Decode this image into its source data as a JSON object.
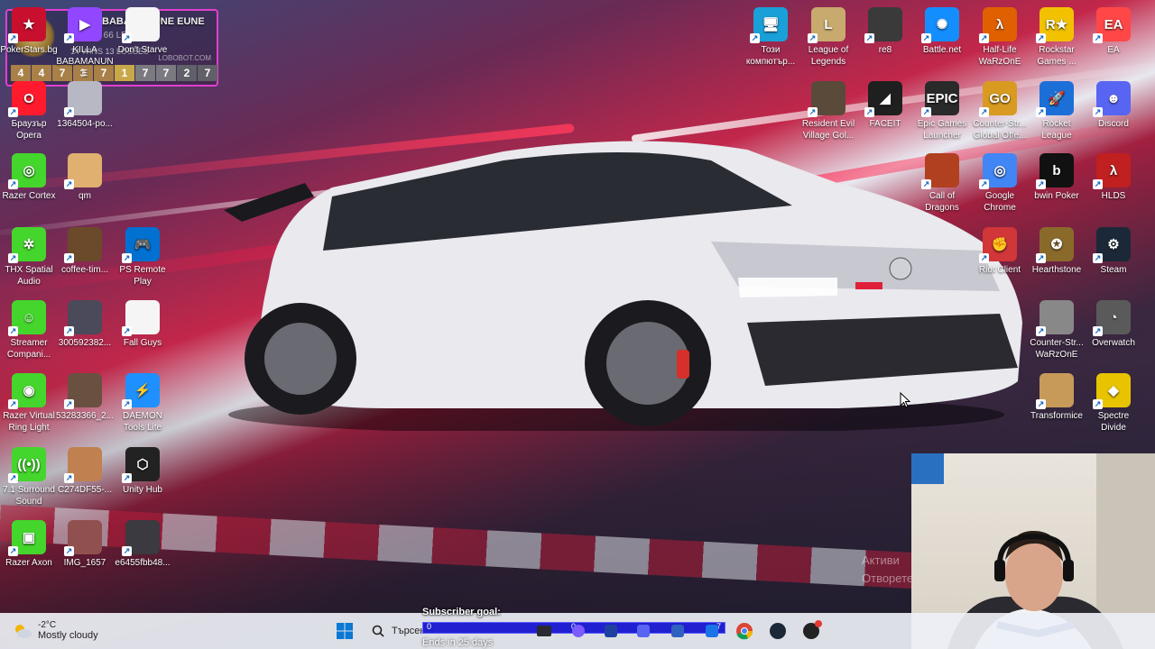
{
  "desktop": {
    "left_icons": [
      {
        "label": "PokerStars.bg",
        "icon": "pokerstars-icon",
        "color": "#c8102e",
        "glyph": "★"
      },
      {
        "label": "KILLA BABAMANUNE",
        "icon": "twitch-icon",
        "color": "#9146ff",
        "glyph": "▶"
      },
      {
        "label": "Don't Starve",
        "icon": "file-icon",
        "color": "#f5f5f5",
        "glyph": ""
      },
      {
        "label": "Браузър Opera",
        "icon": "opera-icon",
        "color": "#ff1b2d",
        "glyph": "O"
      },
      {
        "label": "1364504-po...",
        "icon": "image-thumbnail-icon",
        "color": "#b8b8c4",
        "glyph": ""
      },
      {
        "label": "Razer Cortex",
        "icon": "razer-cortex-icon",
        "color": "#44d62c",
        "glyph": "◎"
      },
      {
        "label": "qm",
        "icon": "image-thumbnail-icon",
        "color": "#e0b070",
        "glyph": ""
      },
      {
        "label": "THX Spatial Audio",
        "icon": "thx-spatial-icon",
        "color": "#44d62c",
        "glyph": "✲"
      },
      {
        "label": "coffee-tim...",
        "icon": "image-thumbnail-icon",
        "color": "#6a4a2a",
        "glyph": ""
      },
      {
        "label": "PS Remote Play",
        "icon": "ps-remote-play-icon",
        "color": "#0070d1",
        "glyph": "🎮"
      },
      {
        "label": "Streamer Compani...",
        "icon": "streamer-companion-icon",
        "color": "#44d62c",
        "glyph": "☺"
      },
      {
        "label": "300592382...",
        "icon": "image-thumbnail-icon",
        "color": "#4a4a5a",
        "glyph": ""
      },
      {
        "label": "Fall Guys",
        "icon": "file-icon",
        "color": "#f5f5f5",
        "glyph": ""
      },
      {
        "label": "Razer Virtual Ring Light",
        "icon": "razer-ring-light-icon",
        "color": "#44d62c",
        "glyph": "◉"
      },
      {
        "label": "53283366_2...",
        "icon": "image-thumbnail-icon",
        "color": "#6a5040",
        "glyph": ""
      },
      {
        "label": "DAEMON Tools Lite",
        "icon": "daemon-tools-icon",
        "color": "#1e90ff",
        "glyph": "⚡"
      },
      {
        "label": "7.1 Surround Sound",
        "icon": "surround-sound-icon",
        "color": "#44d62c",
        "glyph": "((•))"
      },
      {
        "label": "C274DF55-...",
        "icon": "image-thumbnail-icon",
        "color": "#c08050",
        "glyph": ""
      },
      {
        "label": "Unity Hub",
        "icon": "unity-hub-icon",
        "color": "#222222",
        "glyph": "⬡"
      },
      {
        "label": "Razer Axon",
        "icon": "razer-axon-icon",
        "color": "#44d62c",
        "glyph": "▣"
      },
      {
        "label": "IMG_1657",
        "icon": "image-thumbnail-icon",
        "color": "#905050",
        "glyph": ""
      },
      {
        "label": "e6455fbb48...",
        "icon": "image-thumbnail-icon",
        "color": "#3a3a40",
        "glyph": ""
      }
    ],
    "right_icons": [
      {
        "label": "Този компютър...",
        "icon": "this-pc-icon",
        "color": "#1aa0d8",
        "glyph": "🖥"
      },
      {
        "label": "League of Legends",
        "icon": "league-of-legends-icon",
        "color": "#c8aa6e",
        "glyph": "L"
      },
      {
        "label": "re8",
        "icon": "image-thumbnail-icon",
        "color": "#3a3a3a",
        "glyph": ""
      },
      {
        "label": "Battle.net",
        "icon": "battlenet-icon",
        "color": "#148eff",
        "glyph": "✺"
      },
      {
        "label": "Half-Life WaRzOnE",
        "icon": "half-life-icon",
        "color": "#e06000",
        "glyph": "λ"
      },
      {
        "label": "Rockstar Games ...",
        "icon": "rockstar-icon",
        "color": "#f2c200",
        "glyph": "R★"
      },
      {
        "label": "EA",
        "icon": "ea-icon",
        "color": "#ff4747",
        "glyph": "EA"
      },
      {
        "label": "Resident Evil Village Gol...",
        "icon": "resident-evil-icon",
        "color": "#5a4a3a",
        "glyph": ""
      },
      {
        "label": "FACEIT",
        "icon": "faceit-icon",
        "color": "#1f1f1f",
        "glyph": "◢"
      },
      {
        "label": "Epic Games Launcher",
        "icon": "epic-games-icon",
        "color": "#2a2a2a",
        "glyph": "EPIC"
      },
      {
        "label": "Counter-Str... Global Offe...",
        "icon": "csgo-icon",
        "color": "#d89a20",
        "glyph": "GO"
      },
      {
        "label": "Rocket League",
        "icon": "rocket-league-icon",
        "color": "#1d6fd8",
        "glyph": "🚀"
      },
      {
        "label": "Discord",
        "icon": "discord-icon",
        "color": "#5865f2",
        "glyph": "☻"
      },
      {
        "label": "Call of Dragons",
        "icon": "call-of-dragons-icon",
        "color": "#b04020",
        "glyph": ""
      },
      {
        "label": "Google Chrome",
        "icon": "chrome-icon",
        "color": "#4285f4",
        "glyph": "◎"
      },
      {
        "label": "bwin Poker",
        "icon": "bwin-icon",
        "color": "#111111",
        "glyph": "b"
      },
      {
        "label": "HLDS",
        "icon": "hlds-icon",
        "color": "#c02020",
        "glyph": "λ"
      },
      {
        "label": "Riot Client",
        "icon": "riot-client-icon",
        "color": "#d13639",
        "glyph": "✊"
      },
      {
        "label": "Hearthstone",
        "icon": "hearthstone-icon",
        "color": "#8a6a2a",
        "glyph": "✪"
      },
      {
        "label": "Steam",
        "icon": "steam-icon",
        "color": "#1b2838",
        "glyph": "⚙"
      },
      {
        "label": "Counter-Str... WaRzOnE",
        "icon": "counter-strike-icon",
        "color": "#888888",
        "glyph": ""
      },
      {
        "label": "Overwatch",
        "icon": "overwatch-icon",
        "color": "#5a5a5a",
        "glyph": "◔"
      },
      {
        "label": "Transformice",
        "icon": "transformice-icon",
        "color": "#c89a5a",
        "glyph": ""
      },
      {
        "label": "Spectre Divide",
        "icon": "spectre-divide-icon",
        "color": "#e8c400",
        "glyph": "◆"
      }
    ]
  },
  "overlay": {
    "title": "KILLA BABAMANUNE EUNE",
    "sub": "GOLD I 66 LP",
    "wins": "14 WINS 13 LOSSES",
    "site": "LOBOBOT.COM",
    "cells": [
      "4",
      "4",
      "7",
      "3",
      "7",
      "1",
      "7",
      "7",
      "2",
      "7"
    ]
  },
  "watermark": {
    "line1": "Активи",
    "line2": "Отворете"
  },
  "taskbar": {
    "weather_temp": "-2°C",
    "weather_desc": "Mostly cloudy",
    "search_placeholder": "Търсен",
    "subscriber_goal": {
      "title": "Subscriber goal:",
      "start": "0",
      "current": "0",
      "target": "7",
      "ends": "Ends in 25 days"
    }
  }
}
